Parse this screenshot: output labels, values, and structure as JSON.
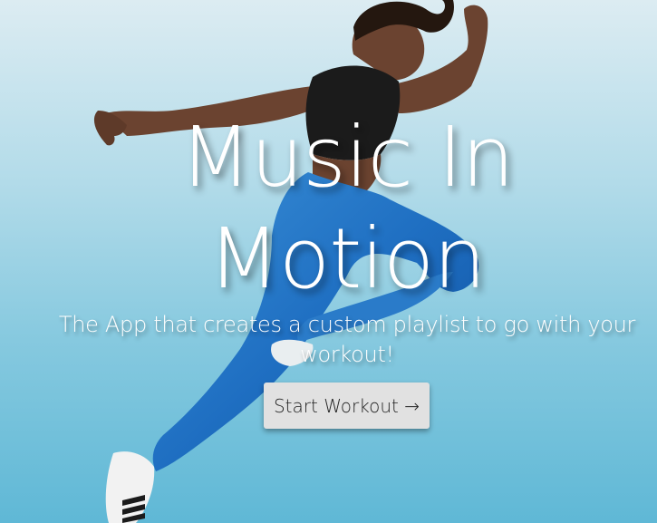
{
  "hero": {
    "title_line1": "Music In",
    "title_line2": "Motion",
    "tagline": "The App that creates a custom playlist to go with your workout!",
    "image_name": "athlete-running-image"
  },
  "cta": {
    "label": "Start Workout →"
  }
}
